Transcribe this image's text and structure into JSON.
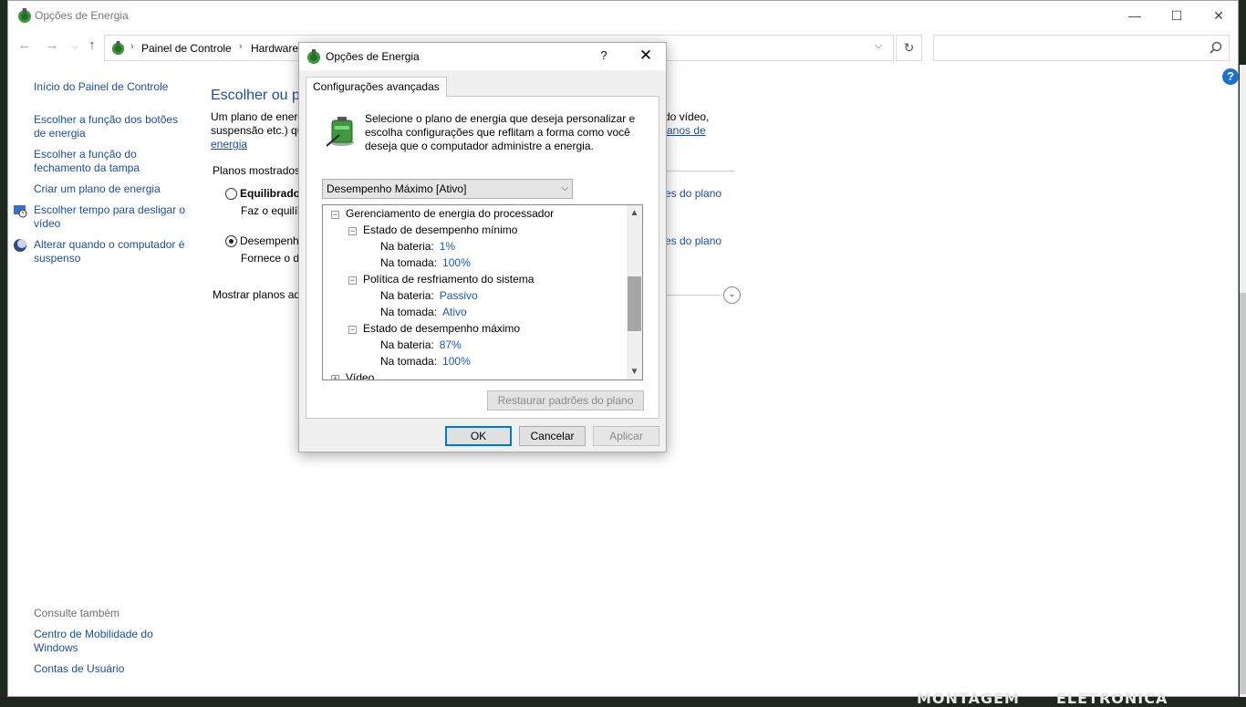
{
  "window": {
    "title": "Opções de Energia",
    "controls": {
      "minimize": "—",
      "maximize": "☐",
      "close": "✕"
    }
  },
  "address": {
    "crumbs": [
      "Painel de Controle",
      "Hardware"
    ],
    "separator": "›",
    "refresh": "↻",
    "dropdown": "⌵"
  },
  "nav": {
    "back": "←",
    "forward": "→",
    "recent": "⌵",
    "up": "↑"
  },
  "search": {
    "placeholder": ""
  },
  "help": "?",
  "left_pane": {
    "links": [
      "Início do Painel de Controle",
      "Escolher a função dos botões de energia",
      "Escolher a função do fechamento da tampa",
      "Criar um plano de energia",
      "Escolher tempo para desligar o vídeo",
      "Alterar quando o computador é suspenso"
    ],
    "see_also_heading": "Consulte também",
    "see_also_links": [
      "Centro de Mobilidade do Windows",
      "Contas de Usuário"
    ]
  },
  "content": {
    "title": "Escolher ou pe",
    "intro_line1_left": "Um plano de energ",
    "intro_line1_right": "do vídeo,",
    "intro_line2_left": "suspensão etc.) qu",
    "intro_line2_right": "anos de",
    "intro_line3": "energia",
    "plans_shown_label": "Planos mostrados",
    "plan1_name": "Equilibrado",
    "plan1_desc": "Faz o equilíb",
    "plan1_link": "es do plano",
    "plan2_name": "Desempenh",
    "plan2_desc": "Fornece o d",
    "plan2_link": "es do plano",
    "show_more_plans": "Mostrar planos ad",
    "expand": "⌄"
  },
  "dialog": {
    "title": "Opções de Energia",
    "help": "?",
    "close": "✕",
    "tab": "Configurações avançadas",
    "description": "Selecione o plano de energia que deseja personalizar e escolha configurações que reflitam a forma como você deseja que o computador administre a energia.",
    "selected_plan": "Desempenho Máximo [Ativo]",
    "tree": {
      "group": "Gerenciamento de energia do processador",
      "min_state": "Estado de desempenho mínimo",
      "min_battery_label": "Na bateria:",
      "min_battery_value": "1%",
      "min_plugged_label": "Na tomada:",
      "min_plugged_value": "100%",
      "cooling": "Política de resfriamento do sistema",
      "cool_battery_label": "Na bateria:",
      "cool_battery_value": "Passivo",
      "cool_plugged_label": "Na tomada:",
      "cool_plugged_value": "Ativo",
      "max_state": "Estado de desempenho máximo",
      "max_battery_label": "Na bateria:",
      "max_battery_value": "87%",
      "max_plugged_label": "Na tomada:",
      "max_plugged_value": "100%",
      "next_group": "Vídeo"
    },
    "restore_button": "Restaurar padrões do plano",
    "ok": "OK",
    "cancel": "Cancelar",
    "apply": "Aplicar"
  },
  "background_text": [
    "MONTAGEM",
    "ELETRONICA"
  ]
}
